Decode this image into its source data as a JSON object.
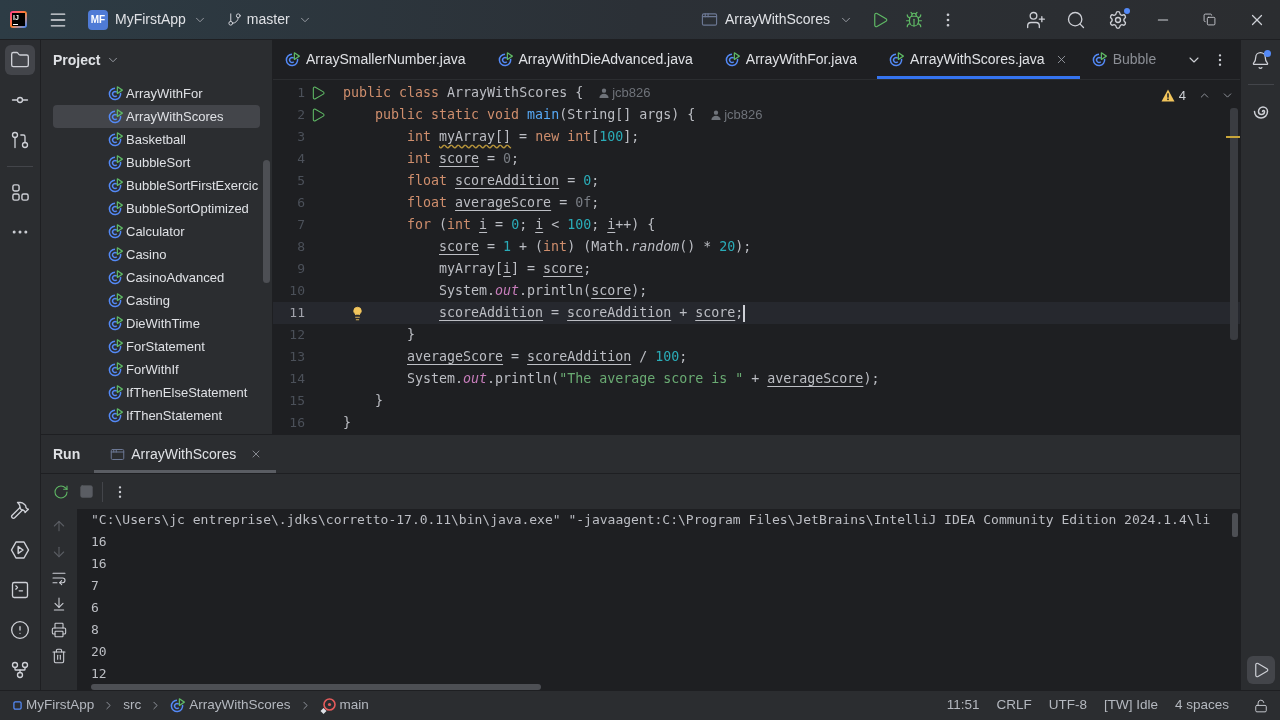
{
  "title_bar": {
    "logo": "IJ",
    "project_badge": "MF",
    "project": "MyFirstApp",
    "branch": "master",
    "run_config": "ArrayWithScores",
    "settings_badge": true
  },
  "tool_strip": {
    "project_open": true,
    "run_open": true,
    "notifications_unread": true
  },
  "project": {
    "title": "Project",
    "items": [
      {
        "label": "ArrayWithFor",
        "selected": false
      },
      {
        "label": "ArrayWithScores",
        "selected": true
      },
      {
        "label": "Basketball",
        "selected": false
      },
      {
        "label": "BubbleSort",
        "selected": false
      },
      {
        "label": "BubbleSortFirstExercic",
        "selected": false
      },
      {
        "label": "BubbleSortOptimized",
        "selected": false
      },
      {
        "label": "Calculator",
        "selected": false
      },
      {
        "label": "Casino",
        "selected": false
      },
      {
        "label": "CasinoAdvanced",
        "selected": false
      },
      {
        "label": "Casting",
        "selected": false
      },
      {
        "label": "DieWithTime",
        "selected": false
      },
      {
        "label": "ForStatement",
        "selected": false
      },
      {
        "label": "ForWithIf",
        "selected": false
      },
      {
        "label": "IfThenElseStatement",
        "selected": false
      },
      {
        "label": "IfThenStatement",
        "selected": false
      }
    ]
  },
  "editor": {
    "tabs": [
      {
        "label": "ArraySmallerNumber.java",
        "selected": false
      },
      {
        "label": "ArrayWithDieAdvanced.java",
        "selected": false
      },
      {
        "label": "ArrayWithFor.java",
        "selected": false
      },
      {
        "label": "ArrayWithScores.java",
        "selected": true
      },
      {
        "label": "Bubble",
        "selected": false
      }
    ],
    "warnings": "4",
    "lines": [
      {
        "number": "1",
        "current": false,
        "runnable": true,
        "bulb": false,
        "author": "jcb826",
        "tokens": [
          {
            "kind": "kw",
            "text": "public class "
          },
          {
            "kind": "plain",
            "text": "ArrayWithScores {"
          }
        ],
        "children": [
          {
            "number": "2",
            "current": false,
            "runnable": true,
            "bulb": false,
            "author": "jcb826",
            "tokens": [
              {
                "kind": "kw",
                "text": "public static void "
              },
              {
                "kind": "decl",
                "text": "main"
              },
              {
                "kind": "plain",
                "text": "(String[] args) {"
              }
            ],
            "children": [
              {
                "number": "3",
                "current": false,
                "runnable": false,
                "bulb": false,
                "tokens": [
                  {
                    "kind": "kw",
                    "text": "int "
                  },
                  {
                    "kind": "warn",
                    "text": "myArray[]"
                  },
                  {
                    "kind": "plain",
                    "text": " = "
                  },
                  {
                    "kind": "kw",
                    "text": "new int"
                  },
                  {
                    "kind": "plain",
                    "text": "["
                  },
                  {
                    "kind": "num",
                    "text": "100"
                  },
                  {
                    "kind": "plain",
                    "text": "];"
                  }
                ]
              },
              {
                "number": "4",
                "current": false,
                "runnable": false,
                "bulb": false,
                "tokens": [
                  {
                    "kind": "kw",
                    "text": "int "
                  },
                  {
                    "kind": "var",
                    "text": "score"
                  },
                  {
                    "kind": "plain",
                    "text": " = "
                  },
                  {
                    "kind": "dim",
                    "text": "0"
                  },
                  {
                    "kind": "plain",
                    "text": ";"
                  }
                ]
              },
              {
                "number": "5",
                "current": false,
                "runnable": false,
                "bulb": false,
                "tokens": [
                  {
                    "kind": "kw",
                    "text": "float "
                  },
                  {
                    "kind": "var",
                    "text": "scoreAddition"
                  },
                  {
                    "kind": "plain",
                    "text": " = "
                  },
                  {
                    "kind": "num",
                    "text": "0"
                  },
                  {
                    "kind": "plain",
                    "text": ";"
                  }
                ]
              },
              {
                "number": "6",
                "current": false,
                "runnable": false,
                "bulb": false,
                "tokens": [
                  {
                    "kind": "kw",
                    "text": "float "
                  },
                  {
                    "kind": "var",
                    "text": "averageScore"
                  },
                  {
                    "kind": "plain",
                    "text": " = "
                  },
                  {
                    "kind": "dim",
                    "text": "0f"
                  },
                  {
                    "kind": "plain",
                    "text": ";"
                  }
                ]
              },
              {
                "number": "7",
                "current": false,
                "runnable": false,
                "bulb": false,
                "tokens": [
                  {
                    "kind": "kw",
                    "text": "for "
                  },
                  {
                    "kind": "plain",
                    "text": "("
                  },
                  {
                    "kind": "kw",
                    "text": "int "
                  },
                  {
                    "kind": "var",
                    "text": "i"
                  },
                  {
                    "kind": "plain",
                    "text": " = "
                  },
                  {
                    "kind": "num",
                    "text": "0"
                  },
                  {
                    "kind": "plain",
                    "text": "; "
                  },
                  {
                    "kind": "var",
                    "text": "i"
                  },
                  {
                    "kind": "plain",
                    "text": " < "
                  },
                  {
                    "kind": "num",
                    "text": "100"
                  },
                  {
                    "kind": "plain",
                    "text": "; "
                  },
                  {
                    "kind": "var",
                    "text": "i"
                  },
                  {
                    "kind": "plain",
                    "text": "++) {"
                  }
                ],
                "children": [
                  {
                    "number": "8",
                    "current": false,
                    "runnable": false,
                    "bulb": false,
                    "tokens": [
                      {
                        "kind": "var",
                        "text": "score"
                      },
                      {
                        "kind": "plain",
                        "text": " = "
                      },
                      {
                        "kind": "num",
                        "text": "1"
                      },
                      {
                        "kind": "plain",
                        "text": " + ("
                      },
                      {
                        "kind": "kw",
                        "text": "int"
                      },
                      {
                        "kind": "plain",
                        "text": ") (Math."
                      },
                      {
                        "kind": "italic",
                        "text": "random"
                      },
                      {
                        "kind": "plain",
                        "text": "() * "
                      },
                      {
                        "kind": "num",
                        "text": "20"
                      },
                      {
                        "kind": "plain",
                        "text": ");"
                      }
                    ]
                  },
                  {
                    "number": "9",
                    "current": false,
                    "runnable": false,
                    "bulb": false,
                    "tokens": [
                      {
                        "kind": "plain",
                        "text": "myArray["
                      },
                      {
                        "kind": "var",
                        "text": "i"
                      },
                      {
                        "kind": "plain",
                        "text": "] = "
                      },
                      {
                        "kind": "var",
                        "text": "score"
                      },
                      {
                        "kind": "plain",
                        "text": ";"
                      }
                    ]
                  },
                  {
                    "number": "10",
                    "current": false,
                    "runnable": false,
                    "bulb": false,
                    "tokens": [
                      {
                        "kind": "plain",
                        "text": "System."
                      },
                      {
                        "kind": "field",
                        "text": "out"
                      },
                      {
                        "kind": "plain",
                        "text": ".println("
                      },
                      {
                        "kind": "var",
                        "text": "score"
                      },
                      {
                        "kind": "plain",
                        "text": ");"
                      }
                    ]
                  },
                  {
                    "number": "11",
                    "current": true,
                    "runnable": false,
                    "bulb": true,
                    "tokens": [
                      {
                        "kind": "var",
                        "text": "scoreAddition"
                      },
                      {
                        "kind": "plain",
                        "text": " = "
                      },
                      {
                        "kind": "var",
                        "text": "scoreAddition"
                      },
                      {
                        "kind": "plain",
                        "text": " + "
                      },
                      {
                        "kind": "var",
                        "text": "score"
                      },
                      {
                        "kind": "plain",
                        "text": ";"
                      }
                    ]
                  }
                ]
              },
              {
                "number": "12",
                "current": false,
                "runnable": false,
                "bulb": false,
                "tokens": [
                  {
                    "kind": "plain",
                    "text": "}"
                  }
                ]
              },
              {
                "number": "13",
                "current": false,
                "runnable": false,
                "bulb": false,
                "tokens": [
                  {
                    "kind": "var",
                    "text": "averageScore"
                  },
                  {
                    "kind": "plain",
                    "text": " = "
                  },
                  {
                    "kind": "var",
                    "text": "scoreAddition"
                  },
                  {
                    "kind": "plain",
                    "text": " / "
                  },
                  {
                    "kind": "num",
                    "text": "100"
                  },
                  {
                    "kind": "plain",
                    "text": ";"
                  }
                ]
              },
              {
                "number": "14",
                "current": false,
                "runnable": false,
                "bulb": false,
                "tokens": [
                  {
                    "kind": "plain",
                    "text": "System."
                  },
                  {
                    "kind": "field",
                    "text": "out"
                  },
                  {
                    "kind": "plain",
                    "text": ".println("
                  },
                  {
                    "kind": "str",
                    "text": "\"The average score is \""
                  },
                  {
                    "kind": "plain",
                    "text": " + "
                  },
                  {
                    "kind": "var",
                    "text": "averageScore"
                  },
                  {
                    "kind": "plain",
                    "text": ");"
                  }
                ]
              }
            ]
          },
          {
            "number": "15",
            "current": false,
            "runnable": false,
            "bulb": false,
            "tokens": [
              {
                "kind": "plain",
                "text": "}"
              }
            ]
          }
        ]
      },
      {
        "number": "16",
        "current": false,
        "runnable": false,
        "bulb": false,
        "tokens": [
          {
            "kind": "plain",
            "text": "}"
          }
        ]
      }
    ]
  },
  "run_panel": {
    "title": "Run",
    "tabs": [
      {
        "label": "ArrayWithScores",
        "selected": true
      }
    ],
    "output": [
      "\"C:\\Users\\jc entreprise\\.jdks\\corretto-17.0.11\\bin\\java.exe\" \"-javaagent:C:\\Program Files\\JetBrains\\IntelliJ IDEA Community Edition 2024.1.4\\li",
      "16",
      "16",
      "7",
      "6",
      "8",
      "20",
      "12"
    ]
  },
  "status_bar": {
    "breadcrumbs": [
      {
        "label": "MyFirstApp",
        "kind": "module"
      },
      {
        "label": "src",
        "kind": "folder"
      },
      {
        "label": "ArrayWithScores",
        "kind": "class"
      },
      {
        "label": "main",
        "kind": "method"
      }
    ],
    "items": [
      "11:51",
      "CRLF",
      "UTF-8",
      "[TW] Idle",
      "4 spaces"
    ]
  }
}
